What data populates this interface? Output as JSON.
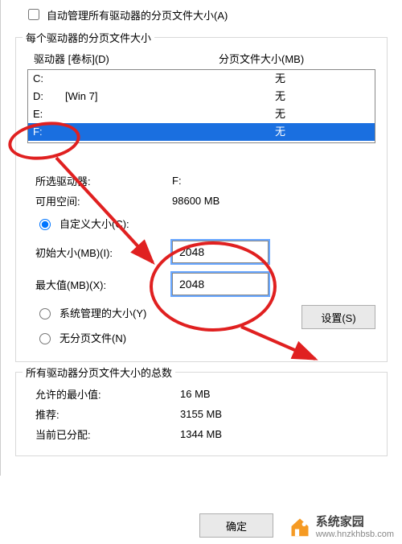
{
  "autoManage": {
    "label": "自动管理所有驱动器的分页文件大小(A)",
    "checked": false
  },
  "perDriveGroup": {
    "title": "每个驱动器的分页文件大小",
    "headers": {
      "drive": "驱动器 [卷标](D)",
      "page": "分页文件大小(MB)"
    },
    "drives": [
      {
        "letter": "C:",
        "label": "",
        "page": "无",
        "selected": false
      },
      {
        "letter": "D:",
        "label": "[Win 7]",
        "page": "无",
        "selected": false
      },
      {
        "letter": "E:",
        "label": "",
        "page": "无",
        "selected": false
      },
      {
        "letter": "F:",
        "label": "",
        "page": "无",
        "selected": true
      }
    ],
    "selectedDrive": {
      "label": "所选驱动器:",
      "value": "F:"
    },
    "freeSpace": {
      "label": "可用空间:",
      "value": "98600 MB"
    },
    "radios": {
      "custom": {
        "label": "自定义大小(C):",
        "checked": true
      },
      "system": {
        "label": "系统管理的大小(Y)",
        "checked": false
      },
      "nopaging": {
        "label": "无分页文件(N)",
        "checked": false
      }
    },
    "initialSize": {
      "label": "初始大小(MB)(I):",
      "value": "2048"
    },
    "maxSize": {
      "label": "最大值(MB)(X):",
      "value": "2048"
    },
    "setButton": "设置(S)"
  },
  "summaryGroup": {
    "title": "所有驱动器分页文件大小的总数",
    "minAllowed": {
      "label": "允许的最小值:",
      "value": "16 MB"
    },
    "recommended": {
      "label": "推荐:",
      "value": "3155 MB"
    },
    "allocated": {
      "label": "当前已分配:",
      "value": "1344 MB"
    }
  },
  "okButton": "确定",
  "watermark": {
    "brand": "系统家园",
    "url": "www.hnzkhbsb.com"
  },
  "anno_color": "#e02020"
}
